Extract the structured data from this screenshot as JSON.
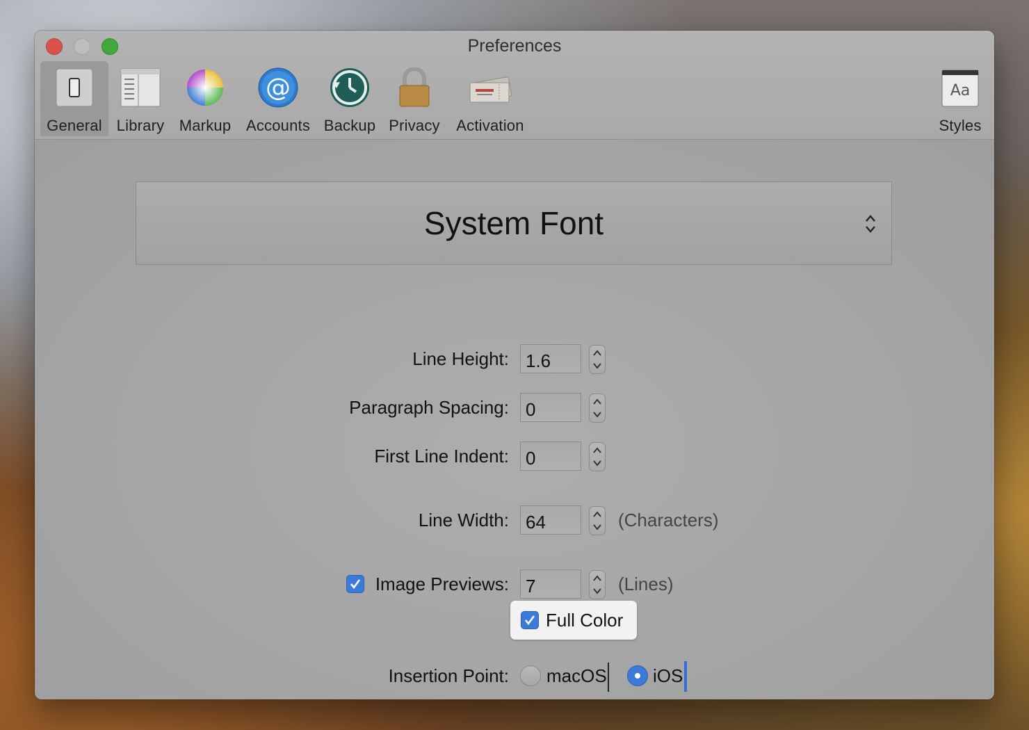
{
  "window": {
    "title": "Preferences"
  },
  "toolbar": {
    "items": [
      {
        "label": "General",
        "icon": "general-switch-icon",
        "selected": true
      },
      {
        "label": "Library",
        "icon": "library-icon"
      },
      {
        "label": "Markup",
        "icon": "color-wheel-icon"
      },
      {
        "label": "Accounts",
        "icon": "at-sign-icon"
      },
      {
        "label": "Backup",
        "icon": "time-machine-icon"
      },
      {
        "label": "Privacy",
        "icon": "padlock-icon"
      },
      {
        "label": "Activation",
        "icon": "ticket-icon"
      },
      {
        "label": "Styles",
        "icon": "font-book-icon"
      }
    ],
    "styles_icon_text": "Aa"
  },
  "font": {
    "selected": "System Font"
  },
  "settings": {
    "line_height": {
      "label": "Line Height:",
      "value": "1.6"
    },
    "paragraph_spacing": {
      "label": "Paragraph Spacing:",
      "value": "0"
    },
    "first_line_indent": {
      "label": "First Line Indent:",
      "value": "0"
    },
    "line_width": {
      "label": "Line Width:",
      "value": "64",
      "unit": "(Characters)"
    },
    "image_previews": {
      "label": "Image Previews:",
      "value": "7",
      "unit": "(Lines)",
      "checked": true
    },
    "full_color": {
      "label": "Full Color",
      "checked": true
    },
    "insertion_point": {
      "label": "Insertion Point:",
      "options": [
        {
          "label": "macOS",
          "selected": false
        },
        {
          "label": "iOS",
          "selected": true
        }
      ]
    }
  },
  "colors": {
    "accent": "#3b7ad8",
    "caret_ios": "#2f6fd6",
    "caret_macos": "#222222"
  }
}
